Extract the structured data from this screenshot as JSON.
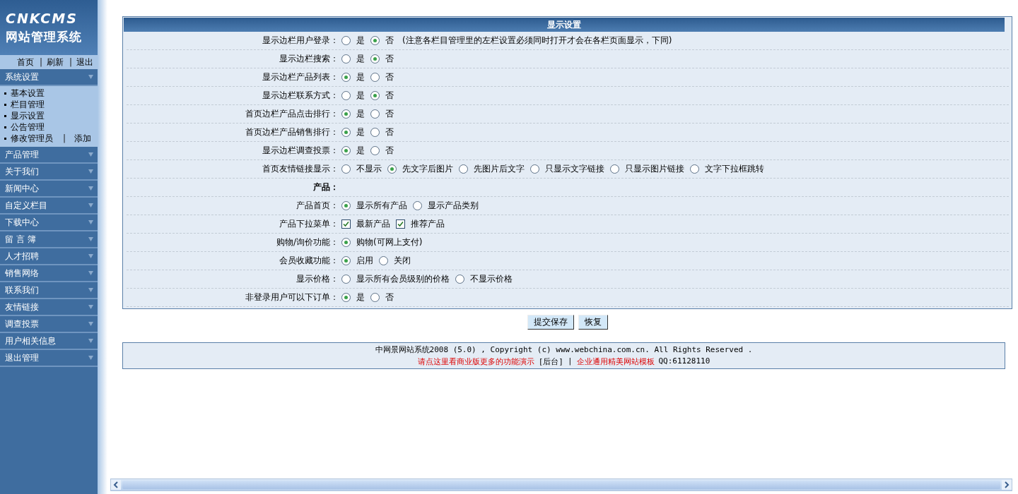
{
  "logo": {
    "line1": "CNKCMS",
    "line2": "网站管理系统"
  },
  "top_links": [
    {
      "text": "首页",
      "kind": "link"
    },
    {
      "text": "|",
      "kind": "separator"
    },
    {
      "text": "刷新",
      "kind": "link"
    },
    {
      "text": "|",
      "kind": "separator"
    },
    {
      "text": "退出",
      "kind": "link"
    }
  ],
  "sidebar": {
    "items": [
      {
        "label": "系统设置",
        "children": [
          {
            "label": "基本设置"
          },
          {
            "label": "栏目管理"
          },
          {
            "label": "显示设置"
          },
          {
            "label": "公告管理"
          },
          {
            "label": "修改管理员",
            "separator": "|",
            "extra": "添加"
          }
        ]
      },
      {
        "label": "产品管理"
      },
      {
        "label": "关于我们"
      },
      {
        "label": "新闻中心"
      },
      {
        "label": "自定义栏目"
      },
      {
        "label": "下载中心"
      },
      {
        "label": "留 言 簿"
      },
      {
        "label": "人才招聘"
      },
      {
        "label": "销售网络"
      },
      {
        "label": "联系我们"
      },
      {
        "label": "友情链接"
      },
      {
        "label": "调查投票"
      },
      {
        "label": "用户相关信息"
      },
      {
        "label": "退出管理"
      }
    ]
  },
  "panel": {
    "title": "显示设置",
    "rows": [
      {
        "kind": "radio",
        "label": "显示边栏用户登录：",
        "options": [
          {
            "label": "是",
            "selected": false
          },
          {
            "label": "否",
            "selected": true
          }
        ],
        "note": "(注意各栏目管理里的左栏设置必须同时打开才会在各栏页面显示，下同)"
      },
      {
        "kind": "radio",
        "label": "显示边栏搜索：",
        "options": [
          {
            "label": "是",
            "selected": false
          },
          {
            "label": "否",
            "selected": true
          }
        ]
      },
      {
        "kind": "radio",
        "label": "显示边栏产品列表：",
        "options": [
          {
            "label": "是",
            "selected": true
          },
          {
            "label": "否",
            "selected": false
          }
        ]
      },
      {
        "kind": "radio",
        "label": "显示边栏联系方式：",
        "options": [
          {
            "label": "是",
            "selected": false
          },
          {
            "label": "否",
            "selected": true
          }
        ]
      },
      {
        "kind": "radio",
        "label": "首页边栏产品点击排行：",
        "options": [
          {
            "label": "是",
            "selected": true
          },
          {
            "label": "否",
            "selected": false
          }
        ]
      },
      {
        "kind": "radio",
        "label": "首页边栏产品销售排行：",
        "options": [
          {
            "label": "是",
            "selected": true
          },
          {
            "label": "否",
            "selected": false
          }
        ]
      },
      {
        "kind": "radio",
        "label": "显示边栏调查投票：",
        "options": [
          {
            "label": "是",
            "selected": true
          },
          {
            "label": "否",
            "selected": false
          }
        ]
      },
      {
        "kind": "radio",
        "label": "首页友情链接显示：",
        "options": [
          {
            "label": "不显示",
            "selected": false
          },
          {
            "label": "先文字后图片",
            "selected": true
          },
          {
            "label": "先图片后文字",
            "selected": false
          },
          {
            "label": "只显示文字链接",
            "selected": false
          },
          {
            "label": "只显示图片链接",
            "selected": false
          },
          {
            "label": "文字下拉框跳转",
            "selected": false
          }
        ]
      },
      {
        "kind": "heading",
        "label": "产品："
      },
      {
        "kind": "radio",
        "label": "产品首页：",
        "options": [
          {
            "label": "显示所有产品",
            "selected": true
          },
          {
            "label": "显示产品类别",
            "selected": false
          }
        ]
      },
      {
        "kind": "checkbox",
        "label": "产品下拉菜单：",
        "options": [
          {
            "label": "最新产品",
            "checked": true
          },
          {
            "label": "推荐产品",
            "checked": true
          }
        ]
      },
      {
        "kind": "radio",
        "label": "购物/询价功能：",
        "options": [
          {
            "label": "购物(可网上支付)",
            "selected": true
          }
        ]
      },
      {
        "kind": "radio",
        "label": "会员收藏功能：",
        "options": [
          {
            "label": "启用",
            "selected": true
          },
          {
            "label": "关闭",
            "selected": false
          }
        ]
      },
      {
        "kind": "radio",
        "label": "显示价格：",
        "options": [
          {
            "label": "显示所有会员级别的价格",
            "selected": false
          },
          {
            "label": "不显示价格",
            "selected": false
          }
        ]
      },
      {
        "kind": "radio",
        "label": "非登录用户可以下订单：",
        "options": [
          {
            "label": "是",
            "selected": true
          },
          {
            "label": "否",
            "selected": false
          }
        ]
      }
    ]
  },
  "buttons": [
    "提交保存",
    "恢复"
  ],
  "footer": {
    "copyright": "中网景网站系统2008 (5.0) , Copyright (c) www.webchina.com.cn. All Rights Reserved .",
    "links": [
      {
        "text": "请点这里看商业版更多的功能演示",
        "kind": "link"
      },
      {
        "text": "[后台]",
        "kind": "plain"
      },
      {
        "text": "|",
        "kind": "plain"
      },
      {
        "text": "企业通用精美网站模板",
        "kind": "link"
      },
      {
        "text": "QQ:61128110",
        "kind": "plain"
      }
    ]
  }
}
